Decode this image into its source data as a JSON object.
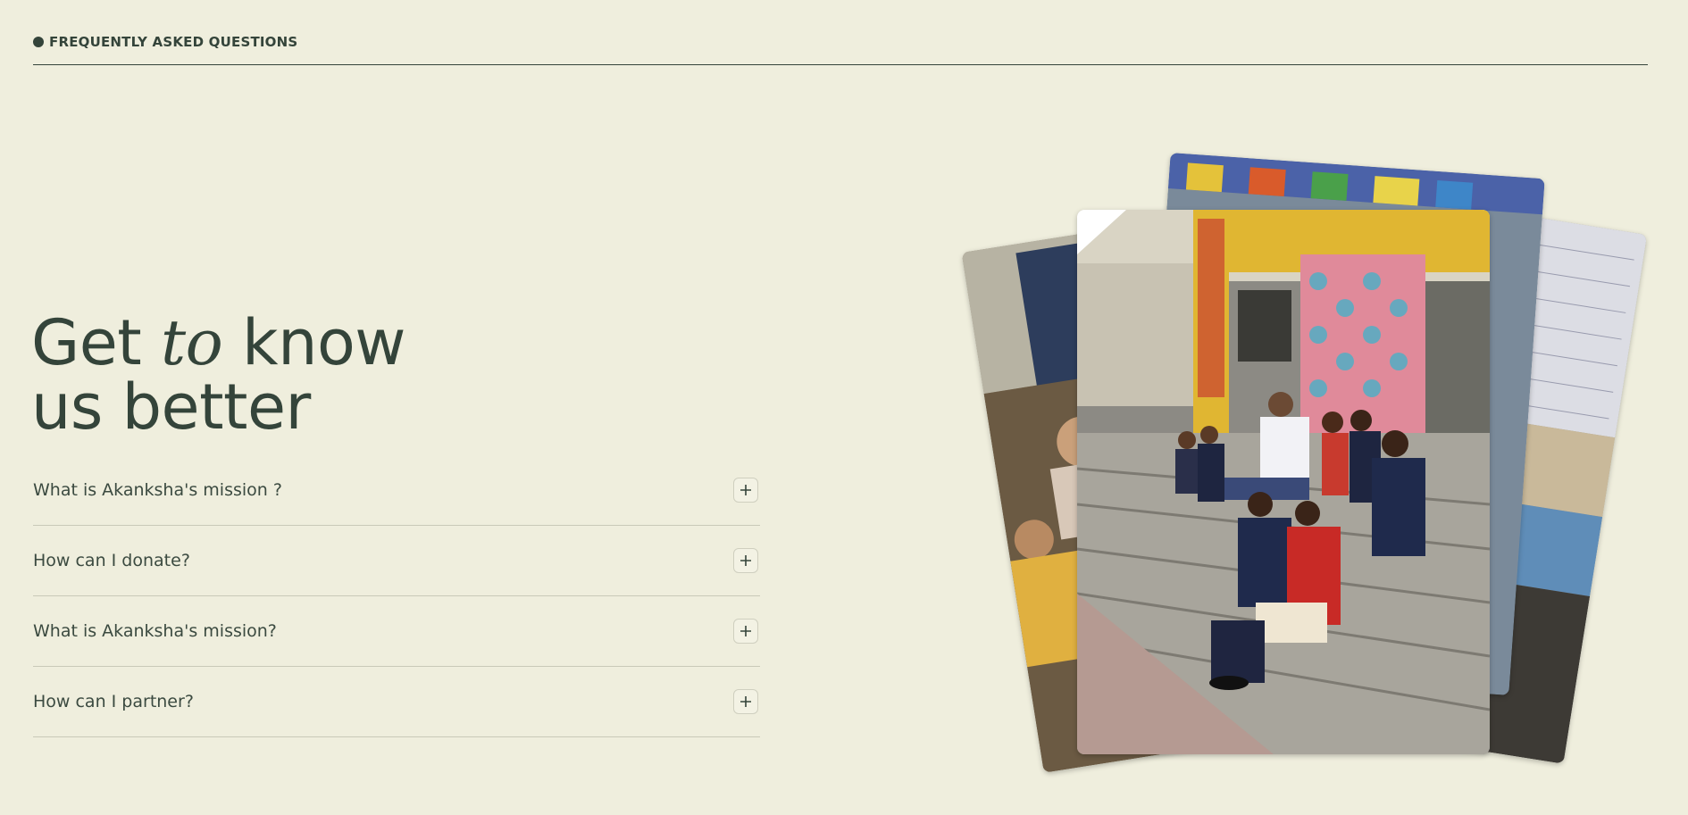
{
  "section": {
    "label": "FREQUENTLY ASKED QUESTIONS"
  },
  "headline": {
    "part1": "Get ",
    "italic": "to",
    "part2": " know",
    "line2": "us better"
  },
  "faq": [
    {
      "question": "What is Akanksha's mission ?"
    },
    {
      "question": "How can I donate?"
    },
    {
      "question": "What is Akanksha's mission?"
    },
    {
      "question": "How can I partner?"
    }
  ],
  "photos": [
    {
      "name": "left-classroom-photo"
    },
    {
      "name": "right-wall-chart-photo"
    },
    {
      "name": "back-mural-photo"
    },
    {
      "name": "front-students-on-steps-photo"
    }
  ],
  "colors": {
    "background": "#efeedd",
    "ink": "#34443a",
    "divider": "#c9c9b8"
  }
}
